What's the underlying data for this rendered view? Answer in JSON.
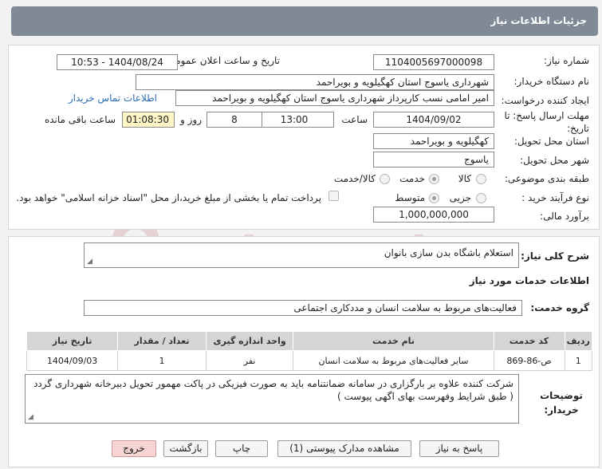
{
  "header": {
    "title": "جزئیات اطلاعات نیاز"
  },
  "details": {
    "need_number_label": "شماره نیاز:",
    "need_number": "1104005697000098",
    "announce_label": "تاریخ و ساعت اعلان عمومی:",
    "announce_value": "1404/08/24 - 10:53",
    "buyer_label": "نام دستگاه خریدار:",
    "buyer_value": "شهرداری یاسوج استان کهگیلویه و بویراحمد",
    "creator_label": "ایجاد کننده درخواست:",
    "creator_value": "امیر امامی نسب کارپرداز شهرداری یاسوج استان کهگیلویه و بویراحمد",
    "contact_link": "اطلاعات تماس خریدار",
    "deadline_label": "مهلت ارسال پاسخ: تا تاریخ:",
    "deadline_date": "1404/09/02",
    "time_label": "ساعت",
    "deadline_time": "13:00",
    "days_value": "8",
    "days_label": "روز و",
    "remaining_value": "01:08:30",
    "remaining_label": "ساعت باقی مانده",
    "province_label": "استان محل تحویل:",
    "province_value": "کهگیلویه و بویراحمد",
    "city_label": "شهر محل تحویل:",
    "city_value": "یاسوج",
    "category_label": "طبقه بندی موضوعی:",
    "category_options": [
      "کالا",
      "خدمت",
      "کالا/خدمت"
    ],
    "category_selected": "خدمت",
    "process_label": "نوع فرآیند خرید :",
    "process_options": [
      "جزیی",
      "متوسط"
    ],
    "process_selected": "متوسط",
    "payment_note": "پرداخت تمام یا بخشی از مبلغ خرید،از محل \"اسناد خزانه اسلامی\" خواهد بود.",
    "budget_label": "برآورد مالی:",
    "budget_value": "1,000,000,000"
  },
  "description": {
    "label": "شرح کلی نیاز:",
    "value": "استعلام باشگاه بدن سازی بانوان"
  },
  "services": {
    "section_title": "اطلاعات خدمات مورد نیاز",
    "group_label": "گروه خدمت:",
    "group_value": "فعالیت‌های مربوط به سلامت انسان و مددکاری اجتماعی",
    "columns": [
      "ردیف",
      "کد خدمت",
      "نام خدمت",
      "واحد اندازه گیری",
      "تعداد / مقدار",
      "تاریخ نیاز"
    ],
    "rows": [
      [
        "1",
        "ص-86-869",
        "سایر فعالیت‌های مربوط به سلامت انسان",
        "نفر",
        "1",
        "1404/09/03"
      ]
    ]
  },
  "buyer_notes": {
    "label": "توضیحات خریدار:",
    "value": "شرکت کننده علاوه بر بارگزاری در سامانه ضمانتنامه باید به صورت فیزیکی در پاکت مهمور تحویل دبیرخانه شهرداری گردد ( طبق شرایط وفهرست بهای اگهی پیوست )"
  },
  "buttons": {
    "reply": "پاسخ به نیاز",
    "view_docs": "مشاهده مدارک پیوستی (1)",
    "print": "چاپ",
    "back": "بازگشت",
    "exit": "خروج"
  },
  "watermark": {
    "text": "AriaTender.neT"
  },
  "colors": {
    "header_bg": "#7f8a96",
    "link": "#2a6db5",
    "remaining_bg": "#fff6c7",
    "exit_bg": "#f7d5d5"
  }
}
